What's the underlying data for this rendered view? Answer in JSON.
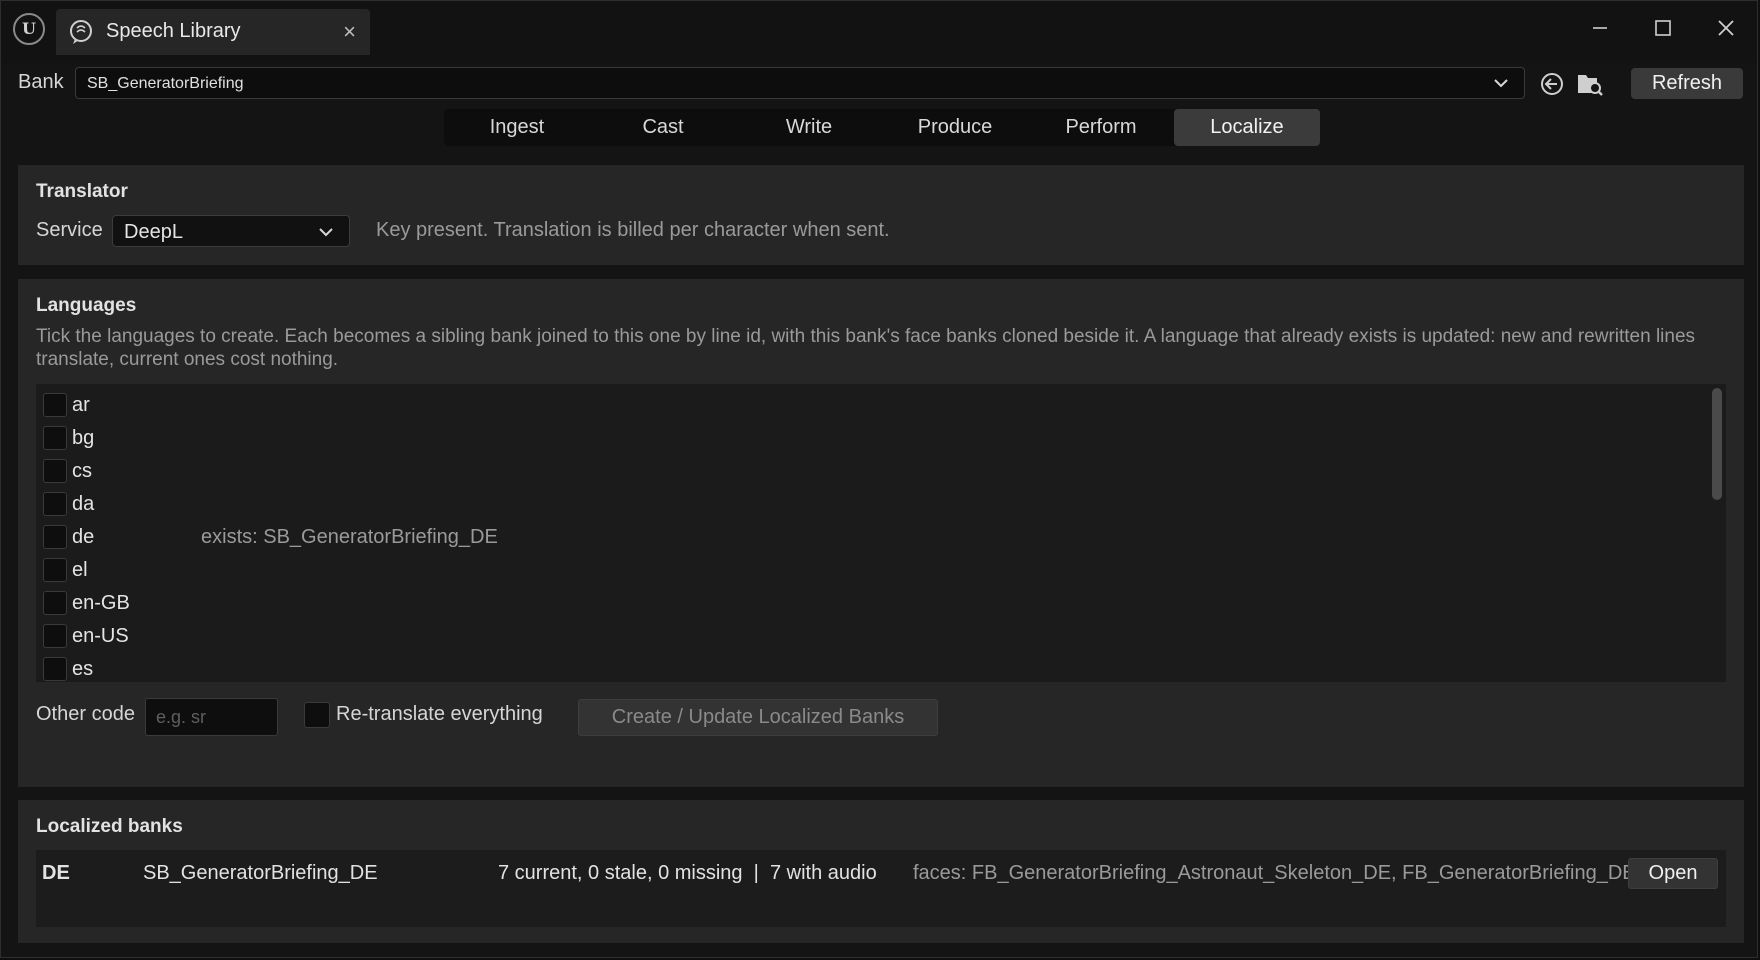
{
  "window": {
    "tab_title": "Speech Library",
    "tab_close": "×"
  },
  "bank": {
    "label": "Bank",
    "selected": "SB_GeneratorBriefing",
    "refresh_label": "Refresh"
  },
  "modes": [
    {
      "label": "Ingest",
      "active": false
    },
    {
      "label": "Cast",
      "active": false
    },
    {
      "label": "Write",
      "active": false
    },
    {
      "label": "Produce",
      "active": false
    },
    {
      "label": "Perform",
      "active": false
    },
    {
      "label": "Localize",
      "active": true
    }
  ],
  "translator": {
    "title": "Translator",
    "service_label": "Service",
    "service_value": "DeepL",
    "status": "Key present. Translation is billed per character when sent."
  },
  "languages": {
    "title": "Languages",
    "description": "Tick the languages to create. Each becomes a sibling bank joined to this one by line id, with this bank's face banks cloned beside it. A language that already exists is updated: new and rewritten lines translate, current ones cost nothing.",
    "items": [
      {
        "code": "ar",
        "note": ""
      },
      {
        "code": "bg",
        "note": ""
      },
      {
        "code": "cs",
        "note": ""
      },
      {
        "code": "da",
        "note": ""
      },
      {
        "code": "de",
        "note": "exists: SB_GeneratorBriefing_DE"
      },
      {
        "code": "el",
        "note": ""
      },
      {
        "code": "en-GB",
        "note": ""
      },
      {
        "code": "en-US",
        "note": ""
      },
      {
        "code": "es",
        "note": ""
      }
    ],
    "other_code_label": "Other code",
    "other_code_placeholder": "e.g. sr",
    "retranslate_label": "Re-translate everything",
    "create_label": "Create / Update Localized Banks"
  },
  "localized": {
    "title": "Localized banks",
    "rows": [
      {
        "lang": "DE",
        "bank": "SB_GeneratorBriefing_DE",
        "status": "7 current, 0 stale, 0 missing  |  7 with audio",
        "faces": "faces: FB_GeneratorBriefing_Astronaut_Skeleton_DE, FB_GeneratorBriefing_DE",
        "open_label": "Open"
      }
    ]
  },
  "icons": {
    "logo": "unreal-logo-icon",
    "tab": "speech-bubble-icon",
    "browse": "browse-back-icon",
    "find": "find-in-folder-icon"
  },
  "colors": {
    "window_bg": "#141414",
    "panel_bg": "#262626",
    "list_bg": "#1b1b1b",
    "active_tab": "#3b3b3b"
  }
}
